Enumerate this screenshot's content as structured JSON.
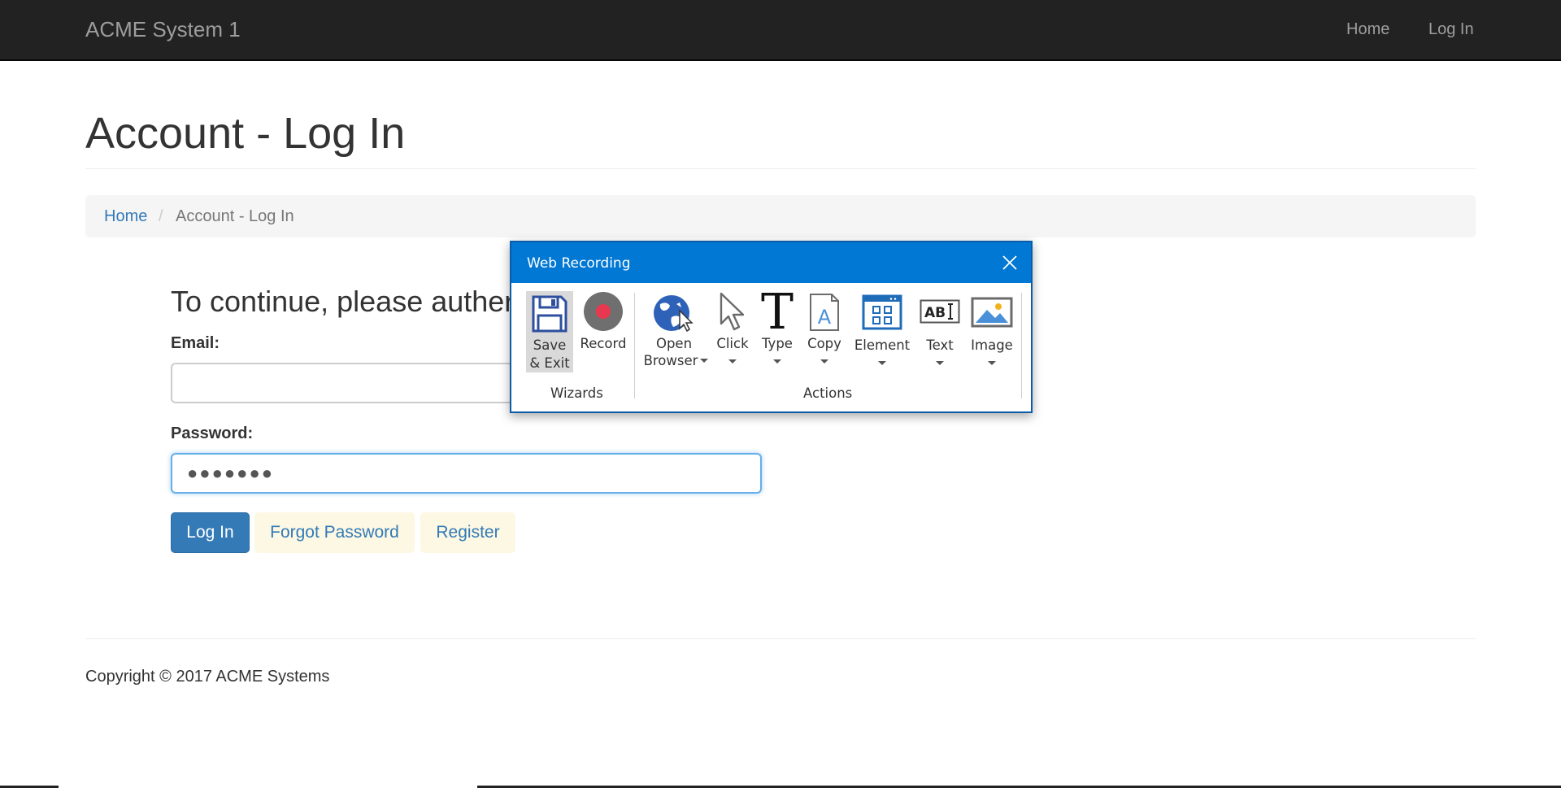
{
  "navbar": {
    "brand": "ACME System 1",
    "links": [
      {
        "label": "Home"
      },
      {
        "label": "Log In"
      }
    ]
  },
  "page": {
    "title": "Account - Log In",
    "breadcrumb": {
      "home": "Home",
      "separator": "/",
      "current": "Account - Log In"
    }
  },
  "form": {
    "heading": "To continue, please auther",
    "email_label": "Email:",
    "email_value": "",
    "password_label": "Password:",
    "password_value": "●●●●●●●",
    "login_label": "Log In",
    "forgot_label": "Forgot Password",
    "register_label": "Register"
  },
  "footer": {
    "copyright": "Copyright © 2017 ACME Systems"
  },
  "recorder": {
    "title": "Web Recording",
    "groups": {
      "wizards": "Wizards",
      "actions": "Actions"
    },
    "tools": {
      "save_exit_line1": "Save",
      "save_exit_line2": "& Exit",
      "record": "Record",
      "open_browser_line1": "Open",
      "open_browser_line2": "Browser",
      "click": "Click",
      "type": "Type",
      "copy": "Copy",
      "element": "Element",
      "text": "Text",
      "image": "Image"
    },
    "colors": {
      "titlebar": "#0078d4",
      "record_dot": "#e8384f",
      "accent_blue": "#2e62b8"
    }
  },
  "colors": {
    "navbar_bg": "#222222",
    "link": "#337ab7",
    "primary_button": "#337ab7",
    "warning_button_bg": "#fcf8e3"
  }
}
